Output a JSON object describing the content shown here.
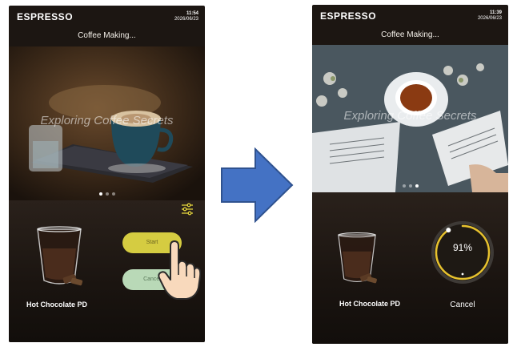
{
  "left_screen": {
    "brand": "ESPRESSO",
    "time": "11:54",
    "date": "2026/06/23",
    "status_title": "Coffee Making...",
    "banner_text": "Exploring Coffee Secrets",
    "product_name": "Hot Chocolate PD",
    "start_label": "Start",
    "cancel_label": "Cancel"
  },
  "right_screen": {
    "brand": "ESPRESSO",
    "time": "11:39",
    "date": "2026/06/23",
    "status_title": "Coffee Making...",
    "banner_text": "Exploring Coffee Secrets",
    "product_name": "Hot Chocolate PD",
    "progress": 0.91,
    "progress_label": "91%",
    "cancel_label": "Cancel"
  },
  "colors": {
    "start_button": "#d5cc41",
    "cancel_button": "#b9d9b7",
    "progress_ring": "#e7c22e",
    "arrow": "#4472c4"
  },
  "icons": {
    "settings": "sliders-icon",
    "pointer": "hand-pointer-icon",
    "transition": "arrow-right-icon"
  }
}
